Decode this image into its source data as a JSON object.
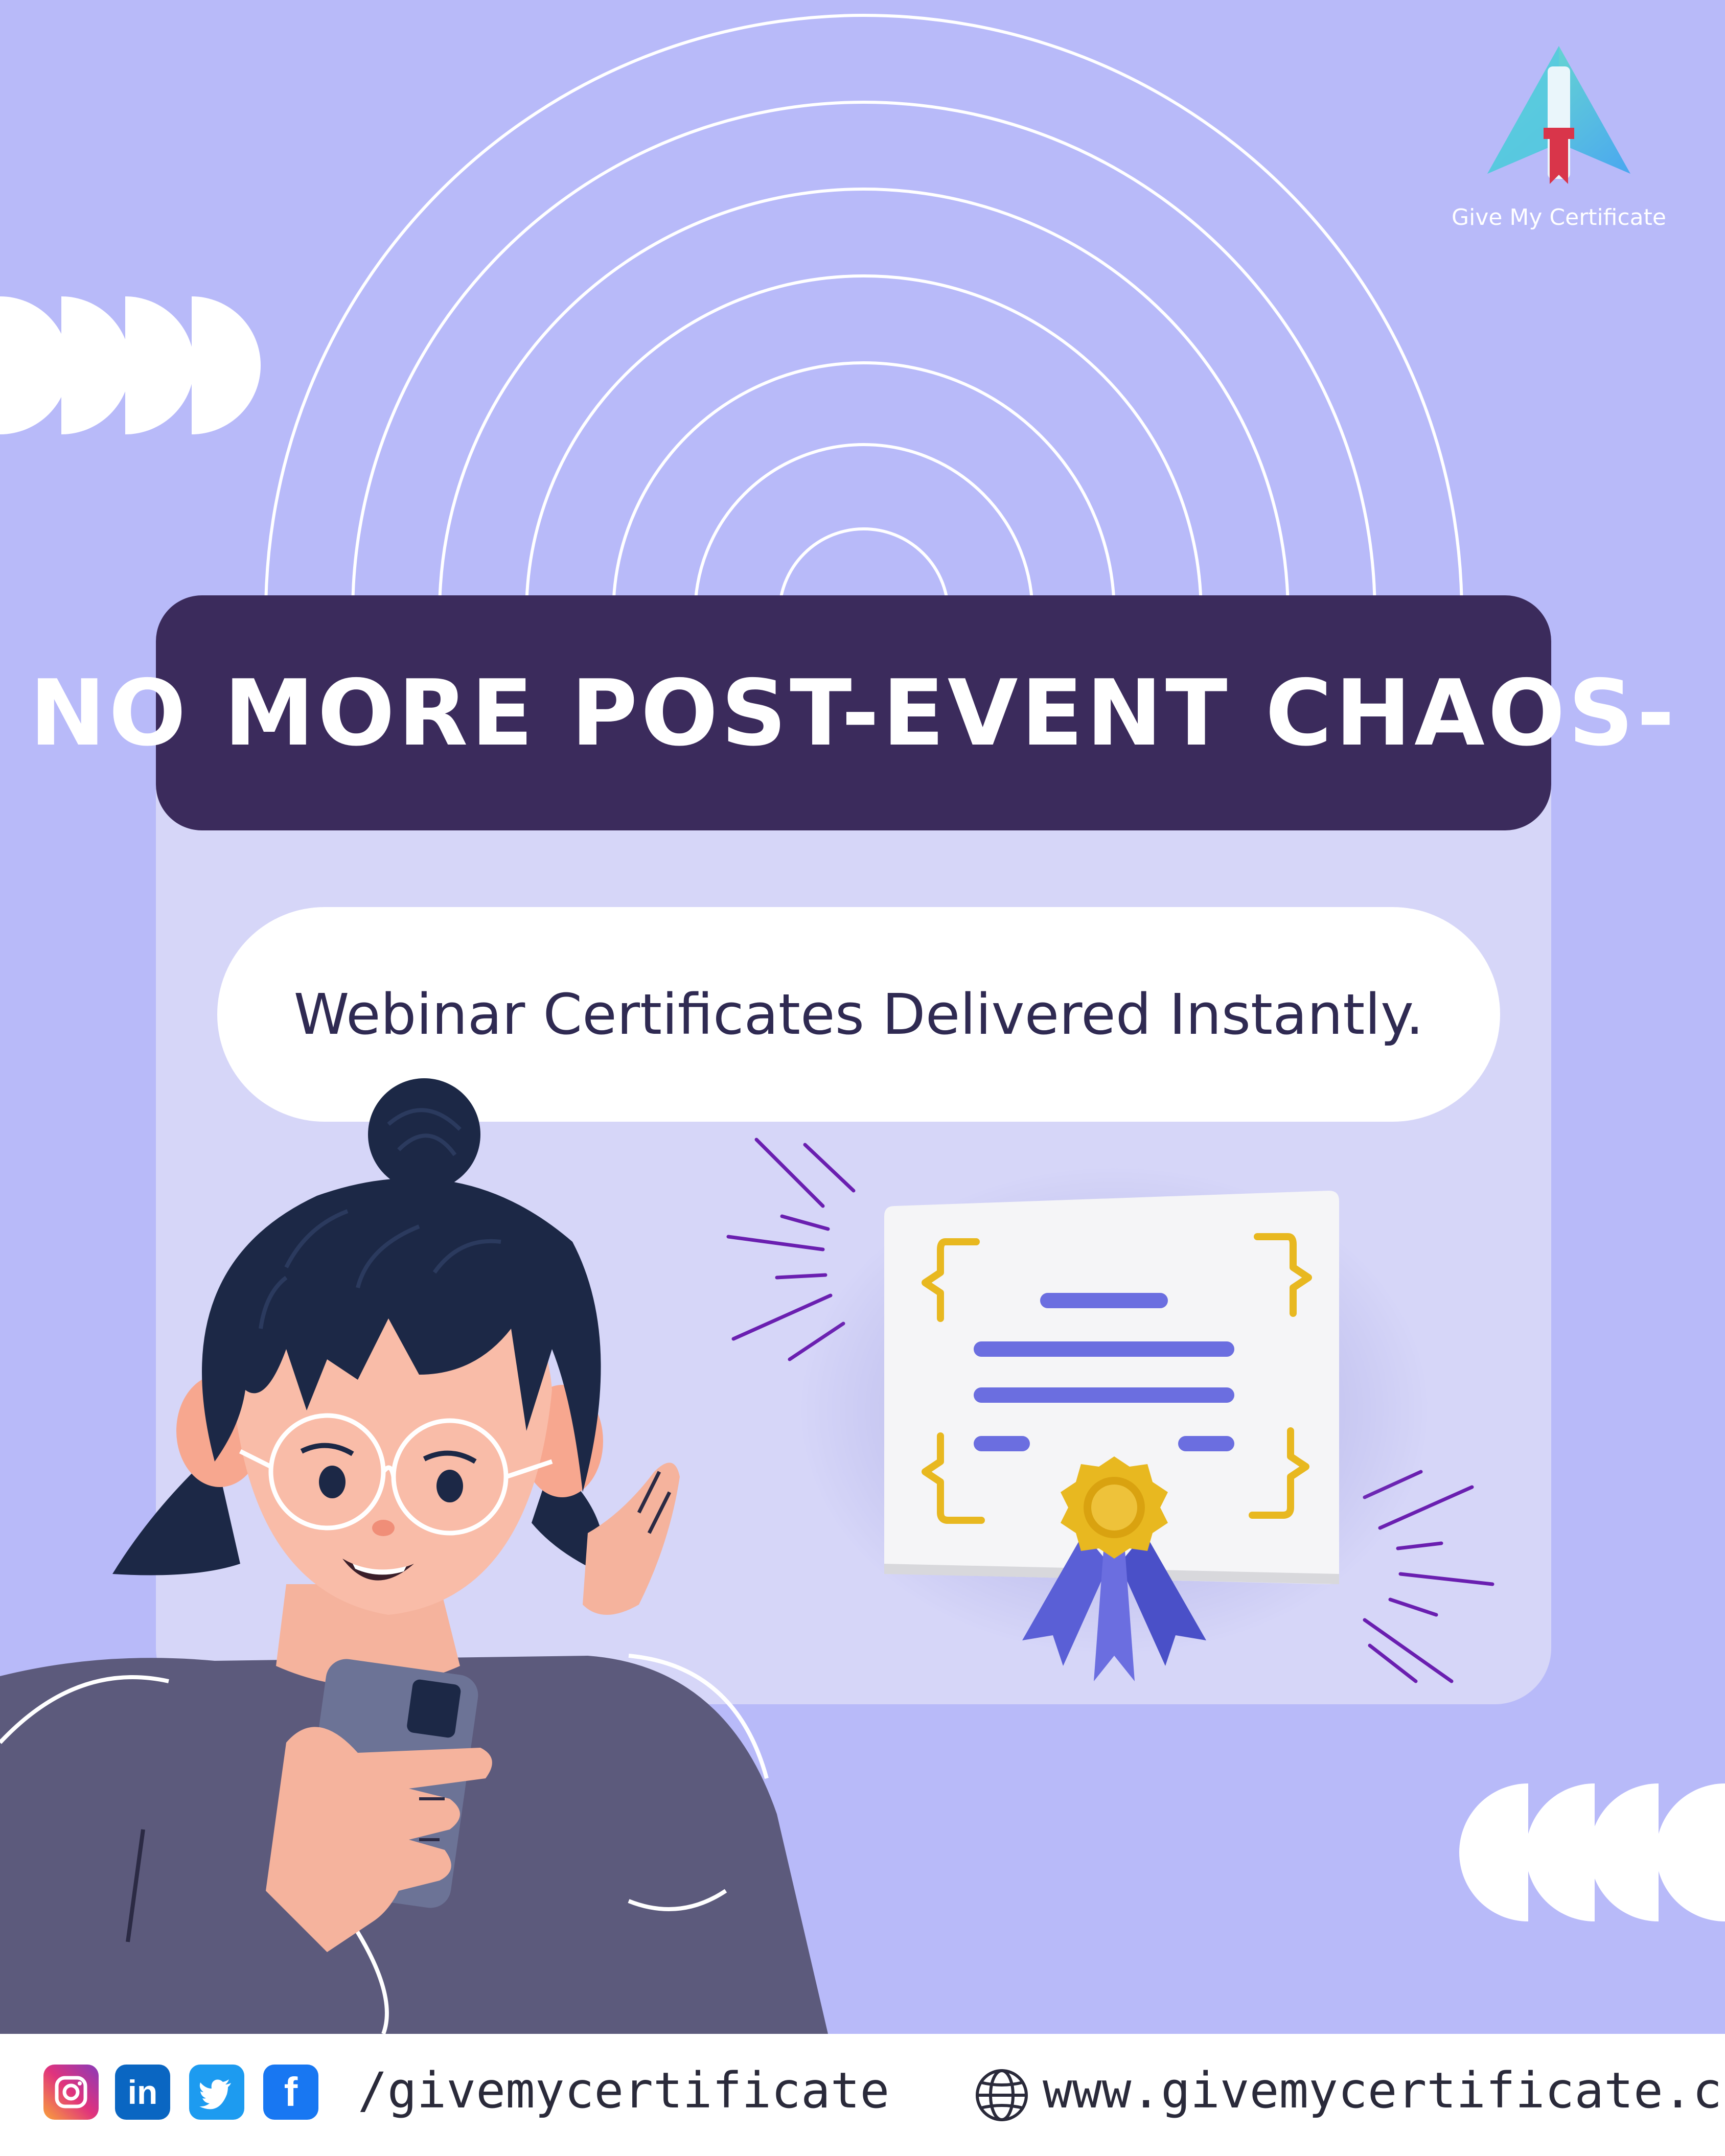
{
  "brand": {
    "logo_icon": "paper-plane-scroll-logo",
    "name": "Give My Certificate"
  },
  "headline": "No More Post-Event Chaos-",
  "subtitle": "Webinar Certificates Delivered Instantly.",
  "illustrations": {
    "certificate": "certificate-with-seal-icon",
    "person": "woman-with-phone-illustration"
  },
  "footer": {
    "social": [
      {
        "name": "instagram-icon"
      },
      {
        "name": "linkedin-icon",
        "glyph": "in"
      },
      {
        "name": "twitter-icon"
      },
      {
        "name": "facebook-icon",
        "glyph": "f"
      }
    ],
    "handle": "/givemycertificate",
    "globe_icon": "globe-icon",
    "website": "www.givemycertificate.com"
  },
  "colors": {
    "background": "#b8baf9",
    "panel": "#d6d6f8",
    "headline_bg": "#3b2b5c",
    "accent_purple": "#6b6ee0",
    "gold": "#e8b820"
  }
}
